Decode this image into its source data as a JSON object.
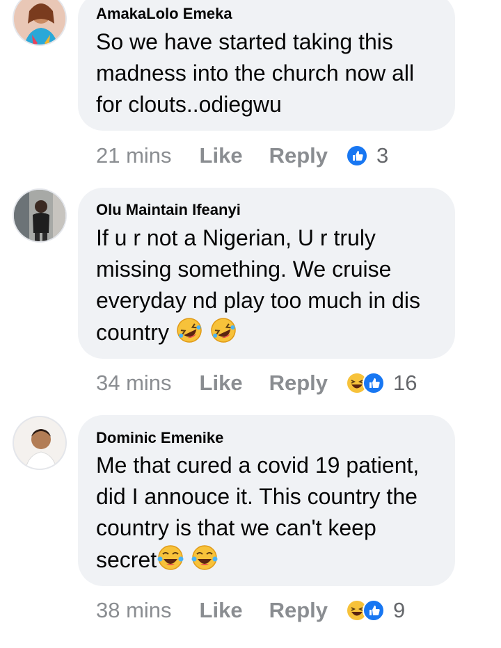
{
  "comments": [
    {
      "author": "AmakaLolo Emeka",
      "text": "So we have started taking this madness into the church now all for clouts..odiegwu",
      "time": "21 mins",
      "like_label": "Like",
      "reply_label": "Reply",
      "reactions": [
        "like"
      ],
      "reaction_count": "3"
    },
    {
      "author": "Olu Maintain Ifeanyi",
      "text": "If u r not a Nigerian, U r truly missing something. We cruise everyday nd play too much in dis country",
      "time": "34 mins",
      "like_label": "Like",
      "reply_label": "Reply",
      "reactions": [
        "haha",
        "like"
      ],
      "reaction_count": "16"
    },
    {
      "author": "Dominic Emenike",
      "text": "Me that cured a covid 19 patient, did I annouce it. This country the country is that we can't keep secret",
      "time": "38 mins",
      "like_label": "Like",
      "reply_label": "Reply",
      "reactions": [
        "haha",
        "like"
      ],
      "reaction_count": "9"
    }
  ],
  "colors": {
    "bubble": "#f0f2f5",
    "meta": "#8a8d91",
    "like_blue": "#1877f2",
    "haha_yellow": "#f7c23a"
  }
}
